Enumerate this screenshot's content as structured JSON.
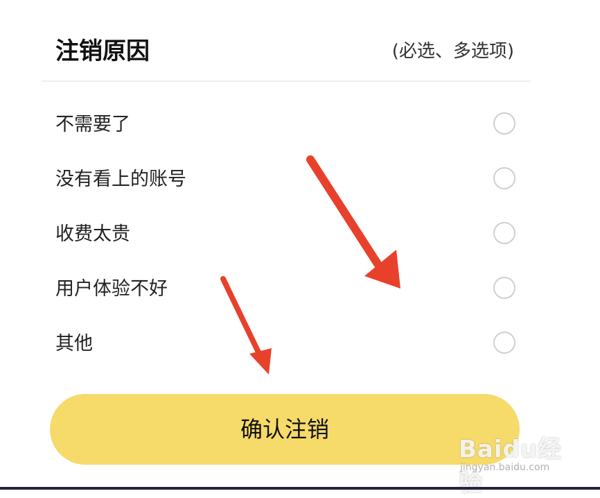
{
  "dialog": {
    "title": "注销原因",
    "subtitle": "(必选、多选项)"
  },
  "options": [
    {
      "label": "不需要了",
      "checked": false
    },
    {
      "label": "没有看上的账号",
      "checked": false
    },
    {
      "label": "收费太贵",
      "checked": false
    },
    {
      "label": "用户体验不好",
      "checked": false
    },
    {
      "label": "其他",
      "checked": false
    }
  ],
  "confirm_button": {
    "label": "确认注销",
    "color": "#f6da6a"
  },
  "annotation": {
    "arrow_color": "#e8412b"
  },
  "watermark": {
    "brand": "Baidu经验",
    "site": "jingyan.baidu.com"
  }
}
